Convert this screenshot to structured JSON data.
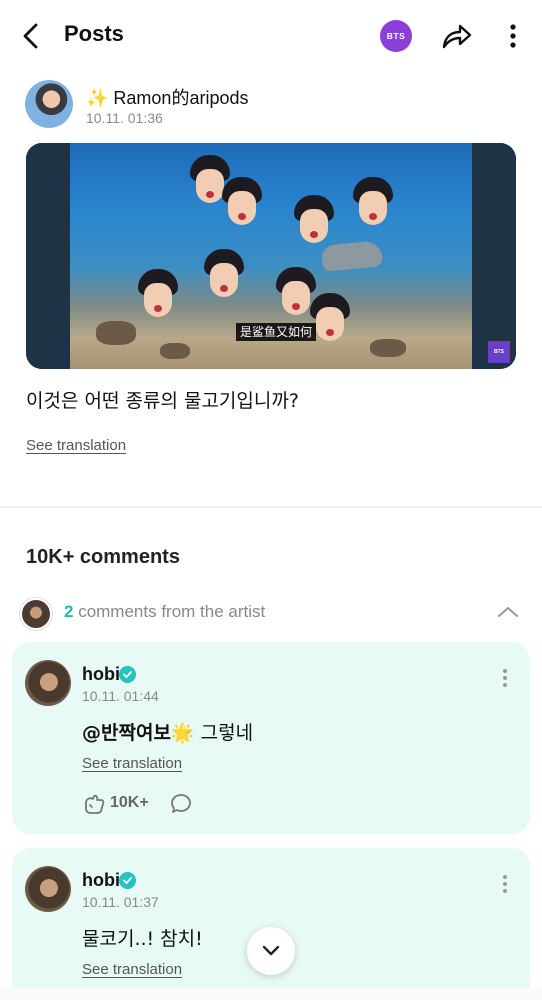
{
  "header": {
    "title": "Posts",
    "badge_label": "BTS",
    "back_icon": "chevron-left-icon",
    "share_icon": "share-icon",
    "more_icon": "more-vertical-icon",
    "badge_color": "#8a3fd9"
  },
  "post": {
    "author_name": "✨ Ramon的aripods",
    "timestamp": "10.11. 01:36",
    "media": {
      "subtitle": "是鲨鱼又如何",
      "logo": "BTS"
    },
    "text": "이것은 어떤 종류의 물고기입니까?",
    "translate_label": "See translation"
  },
  "comments_section": {
    "count_label": "10K+ comments",
    "artist_count": "2",
    "artist_label": " comments from the artist",
    "accent_color": "#1fb9b3"
  },
  "comments": [
    {
      "name": "hobi",
      "time": "10.11. 01:44",
      "mention": "@반짝여보🌟",
      "text": " 그렇네",
      "translate_label": "See translation",
      "like_count": "10K+"
    },
    {
      "name": "hobi",
      "time": "10.11. 01:37",
      "text": "물코기..! 참치!",
      "translate_label": "See translation"
    }
  ],
  "card_color": "#e8faf6"
}
